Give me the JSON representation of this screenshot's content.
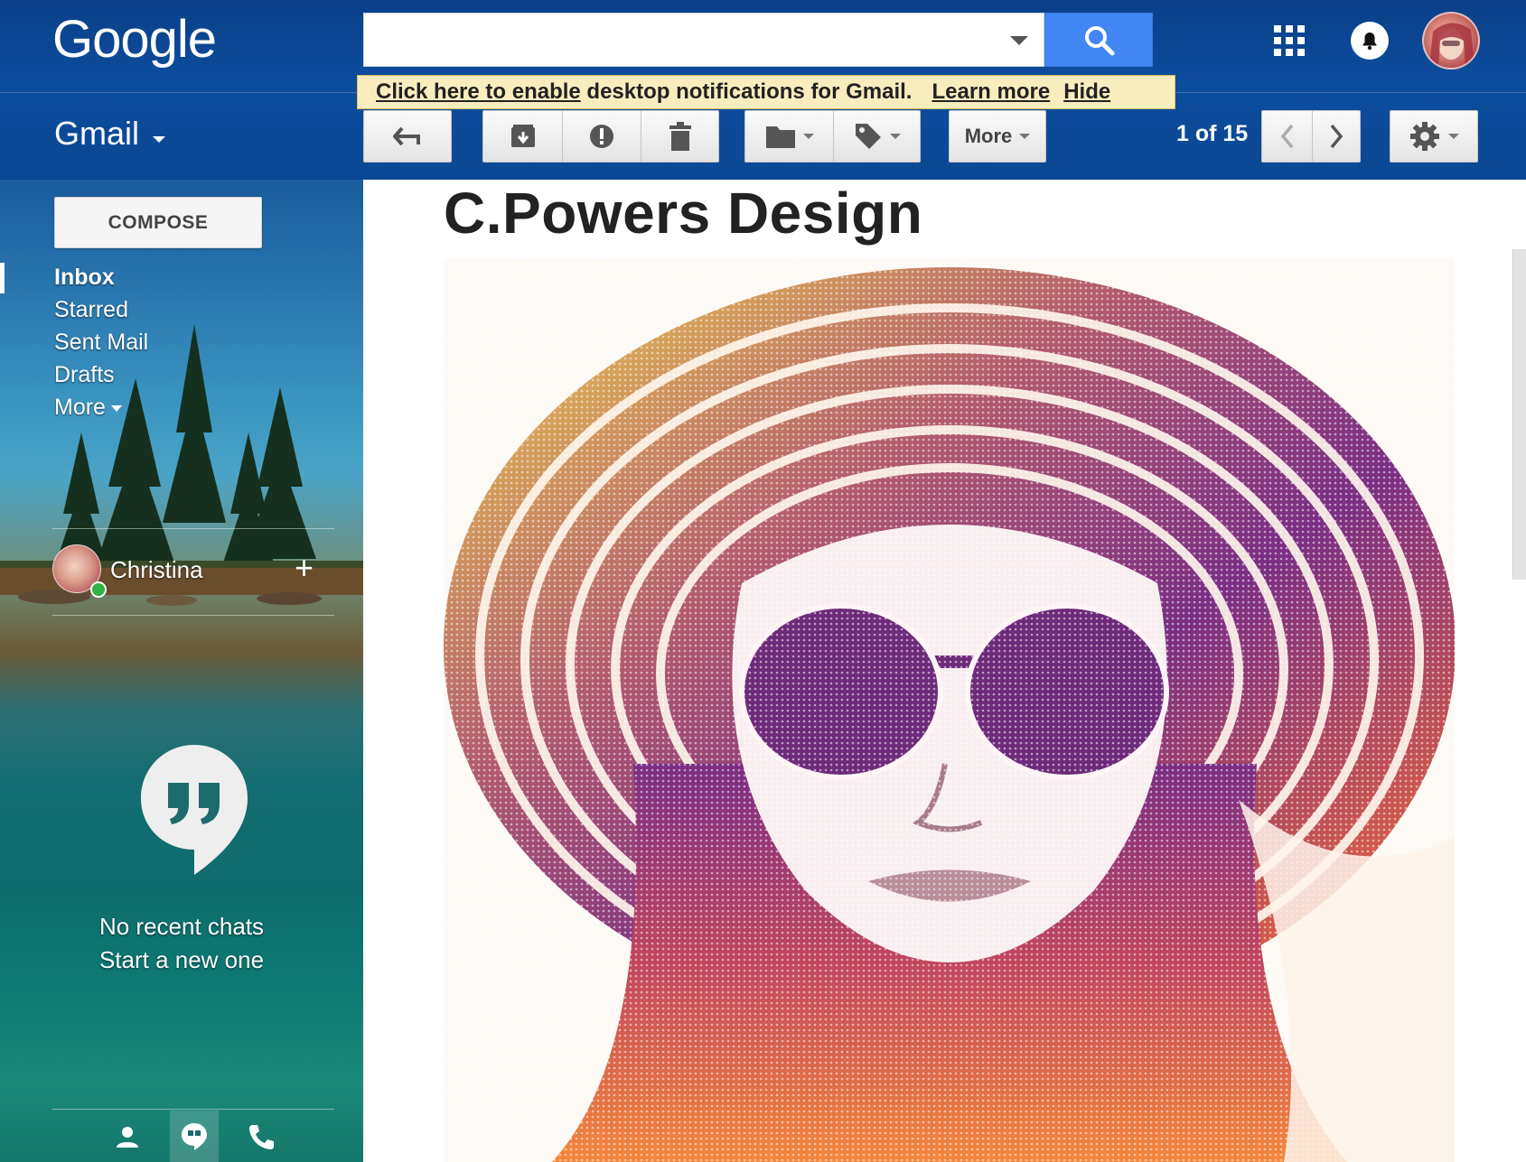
{
  "header": {
    "logo_text": "Google",
    "search_placeholder": "",
    "search_value": "",
    "app_label": "Gmail"
  },
  "notification_banner": {
    "enable_link": "Click here to enable",
    "message": "desktop notifications for Gmail.",
    "learn_more": "Learn more",
    "hide": "Hide"
  },
  "toolbar": {
    "more_label": "More",
    "pager": "1 of 15"
  },
  "sidebar": {
    "compose_label": "COMPOSE",
    "nav": [
      {
        "label": "Inbox",
        "active": true
      },
      {
        "label": "Starred"
      },
      {
        "label": "Sent Mail"
      },
      {
        "label": "Drafts"
      },
      {
        "label": "More"
      }
    ],
    "chat": {
      "user_name": "Christina",
      "status": "online",
      "add_symbol": "+",
      "no_chats": "No recent chats",
      "start_new": "Start a new one"
    }
  },
  "message": {
    "title": "C.Powers Design"
  },
  "colors": {
    "header_blue": "#0d4d9e",
    "search_blue": "#4286f3",
    "banner_bg": "#f9edbe",
    "online_green": "#2fb343"
  },
  "icons": [
    "search-icon",
    "apps-grid-icon",
    "notification-bell-icon",
    "back-arrow-icon",
    "archive-icon",
    "report-spam-icon",
    "delete-icon",
    "folder-icon",
    "label-icon",
    "chevron-left-icon",
    "chevron-right-icon",
    "gear-icon",
    "hangouts-quote-icon",
    "person-icon",
    "phone-icon"
  ]
}
